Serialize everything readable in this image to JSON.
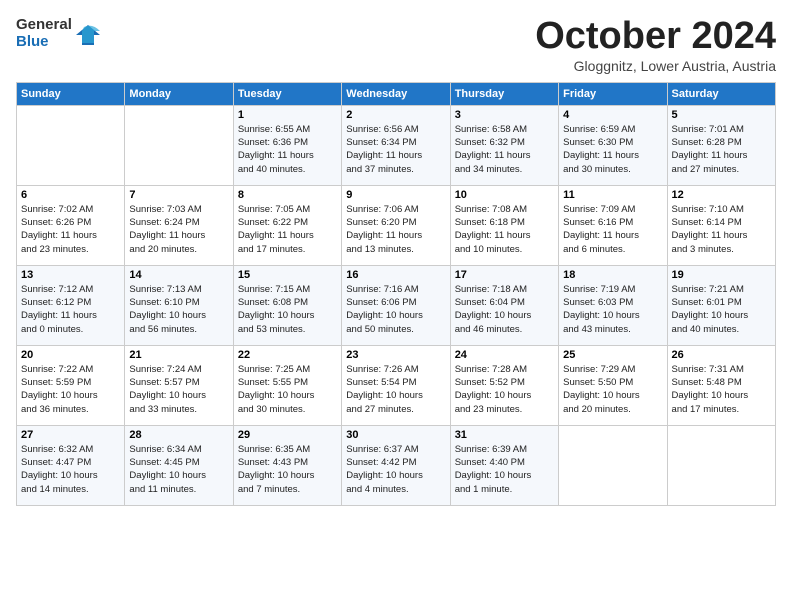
{
  "header": {
    "logo_top": "General",
    "logo_bottom": "Blue",
    "month": "October 2024",
    "location": "Gloggnitz, Lower Austria, Austria"
  },
  "weekdays": [
    "Sunday",
    "Monday",
    "Tuesday",
    "Wednesday",
    "Thursday",
    "Friday",
    "Saturday"
  ],
  "weeks": [
    [
      {
        "day": "",
        "info": ""
      },
      {
        "day": "",
        "info": ""
      },
      {
        "day": "1",
        "info": "Sunrise: 6:55 AM\nSunset: 6:36 PM\nDaylight: 11 hours\nand 40 minutes."
      },
      {
        "day": "2",
        "info": "Sunrise: 6:56 AM\nSunset: 6:34 PM\nDaylight: 11 hours\nand 37 minutes."
      },
      {
        "day": "3",
        "info": "Sunrise: 6:58 AM\nSunset: 6:32 PM\nDaylight: 11 hours\nand 34 minutes."
      },
      {
        "day": "4",
        "info": "Sunrise: 6:59 AM\nSunset: 6:30 PM\nDaylight: 11 hours\nand 30 minutes."
      },
      {
        "day": "5",
        "info": "Sunrise: 7:01 AM\nSunset: 6:28 PM\nDaylight: 11 hours\nand 27 minutes."
      }
    ],
    [
      {
        "day": "6",
        "info": "Sunrise: 7:02 AM\nSunset: 6:26 PM\nDaylight: 11 hours\nand 23 minutes."
      },
      {
        "day": "7",
        "info": "Sunrise: 7:03 AM\nSunset: 6:24 PM\nDaylight: 11 hours\nand 20 minutes."
      },
      {
        "day": "8",
        "info": "Sunrise: 7:05 AM\nSunset: 6:22 PM\nDaylight: 11 hours\nand 17 minutes."
      },
      {
        "day": "9",
        "info": "Sunrise: 7:06 AM\nSunset: 6:20 PM\nDaylight: 11 hours\nand 13 minutes."
      },
      {
        "day": "10",
        "info": "Sunrise: 7:08 AM\nSunset: 6:18 PM\nDaylight: 11 hours\nand 10 minutes."
      },
      {
        "day": "11",
        "info": "Sunrise: 7:09 AM\nSunset: 6:16 PM\nDaylight: 11 hours\nand 6 minutes."
      },
      {
        "day": "12",
        "info": "Sunrise: 7:10 AM\nSunset: 6:14 PM\nDaylight: 11 hours\nand 3 minutes."
      }
    ],
    [
      {
        "day": "13",
        "info": "Sunrise: 7:12 AM\nSunset: 6:12 PM\nDaylight: 11 hours\nand 0 minutes."
      },
      {
        "day": "14",
        "info": "Sunrise: 7:13 AM\nSunset: 6:10 PM\nDaylight: 10 hours\nand 56 minutes."
      },
      {
        "day": "15",
        "info": "Sunrise: 7:15 AM\nSunset: 6:08 PM\nDaylight: 10 hours\nand 53 minutes."
      },
      {
        "day": "16",
        "info": "Sunrise: 7:16 AM\nSunset: 6:06 PM\nDaylight: 10 hours\nand 50 minutes."
      },
      {
        "day": "17",
        "info": "Sunrise: 7:18 AM\nSunset: 6:04 PM\nDaylight: 10 hours\nand 46 minutes."
      },
      {
        "day": "18",
        "info": "Sunrise: 7:19 AM\nSunset: 6:03 PM\nDaylight: 10 hours\nand 43 minutes."
      },
      {
        "day": "19",
        "info": "Sunrise: 7:21 AM\nSunset: 6:01 PM\nDaylight: 10 hours\nand 40 minutes."
      }
    ],
    [
      {
        "day": "20",
        "info": "Sunrise: 7:22 AM\nSunset: 5:59 PM\nDaylight: 10 hours\nand 36 minutes."
      },
      {
        "day": "21",
        "info": "Sunrise: 7:24 AM\nSunset: 5:57 PM\nDaylight: 10 hours\nand 33 minutes."
      },
      {
        "day": "22",
        "info": "Sunrise: 7:25 AM\nSunset: 5:55 PM\nDaylight: 10 hours\nand 30 minutes."
      },
      {
        "day": "23",
        "info": "Sunrise: 7:26 AM\nSunset: 5:54 PM\nDaylight: 10 hours\nand 27 minutes."
      },
      {
        "day": "24",
        "info": "Sunrise: 7:28 AM\nSunset: 5:52 PM\nDaylight: 10 hours\nand 23 minutes."
      },
      {
        "day": "25",
        "info": "Sunrise: 7:29 AM\nSunset: 5:50 PM\nDaylight: 10 hours\nand 20 minutes."
      },
      {
        "day": "26",
        "info": "Sunrise: 7:31 AM\nSunset: 5:48 PM\nDaylight: 10 hours\nand 17 minutes."
      }
    ],
    [
      {
        "day": "27",
        "info": "Sunrise: 6:32 AM\nSunset: 4:47 PM\nDaylight: 10 hours\nand 14 minutes."
      },
      {
        "day": "28",
        "info": "Sunrise: 6:34 AM\nSunset: 4:45 PM\nDaylight: 10 hours\nand 11 minutes."
      },
      {
        "day": "29",
        "info": "Sunrise: 6:35 AM\nSunset: 4:43 PM\nDaylight: 10 hours\nand 7 minutes."
      },
      {
        "day": "30",
        "info": "Sunrise: 6:37 AM\nSunset: 4:42 PM\nDaylight: 10 hours\nand 4 minutes."
      },
      {
        "day": "31",
        "info": "Sunrise: 6:39 AM\nSunset: 4:40 PM\nDaylight: 10 hours\nand 1 minute."
      },
      {
        "day": "",
        "info": ""
      },
      {
        "day": "",
        "info": ""
      }
    ]
  ]
}
